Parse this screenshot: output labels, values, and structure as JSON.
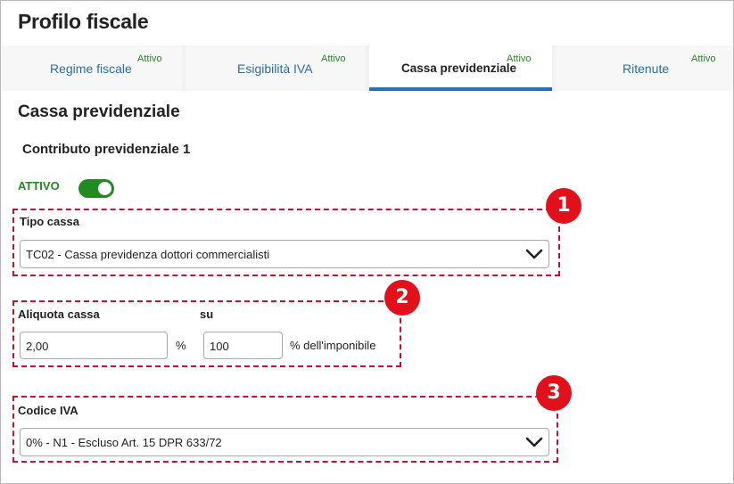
{
  "page": {
    "title": "Profilo fiscale"
  },
  "tabs": [
    {
      "label": "Regime fiscale",
      "badge": "Attivo",
      "active": false
    },
    {
      "label": "Esigibilità IVA",
      "badge": "Attivo",
      "active": false
    },
    {
      "label": "Cassa previdenziale",
      "badge": "Attivo",
      "active": true
    },
    {
      "label": "Ritenute",
      "badge": "Attivo",
      "active": false
    }
  ],
  "section": {
    "title": "Cassa previdenziale",
    "subtitle": "Contributo previdenziale 1",
    "toggle": {
      "label": "ATTIVO",
      "on": true
    }
  },
  "fields": {
    "tipo_cassa": {
      "label": "Tipo cassa",
      "value": "TC02 - Cassa previdenza dottori commercialisti"
    },
    "aliquota": {
      "label": "Aliquota cassa",
      "value": "2,00",
      "unit": "%"
    },
    "su": {
      "label": "su",
      "value": "100",
      "unit": "% dell'imponibile"
    },
    "codice_iva": {
      "label": "Codice IVA",
      "value": "0% - N1 - Escluso Art. 15 DPR 633/72"
    }
  },
  "markers": [
    "1",
    "2",
    "3"
  ],
  "colors": {
    "accent": "#2272b8",
    "link": "#2a6ea8",
    "active_green": "#218a21",
    "annotation_red": "#e0111b"
  }
}
